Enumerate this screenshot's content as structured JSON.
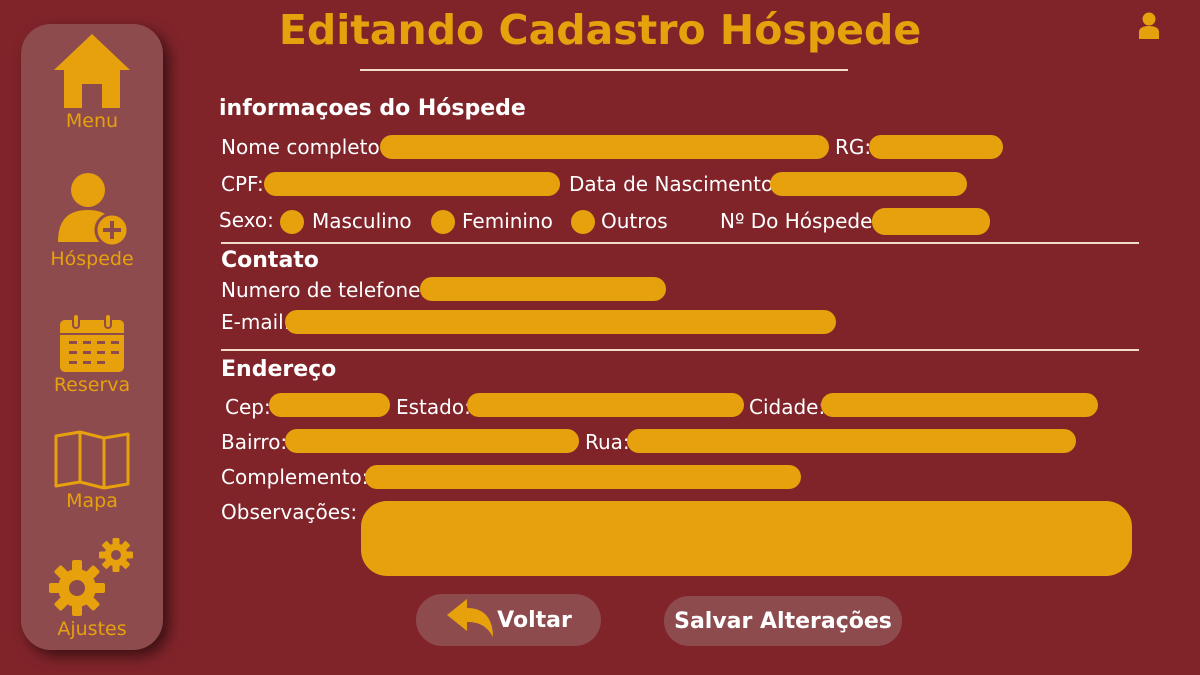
{
  "header": {
    "title": "Editando Cadastro Hóspede"
  },
  "icons": {
    "user": "user-icon",
    "home": "home-icon",
    "add_user": "add-user-icon",
    "calendar": "calendar-icon",
    "map": "map-icon",
    "gears": "gears-icon",
    "back": "back-arrow-icon"
  },
  "colors": {
    "background": "#80242a",
    "sidebar": "#8e4b4e",
    "accent": "#e6a10d",
    "divider": "#f1dcc7"
  },
  "sidebar": {
    "items": [
      {
        "label": "Menu"
      },
      {
        "label": "Hóspede"
      },
      {
        "label": "Reserva"
      },
      {
        "label": "Mapa"
      },
      {
        "label": "Ajustes"
      }
    ]
  },
  "guest_info": {
    "title": "informaçoes do Hóspede",
    "full_name_label": "Nome completo:",
    "rg_label": "RG:",
    "cpf_label": "CPF:",
    "birth_date_label": "Data de Nascimento:",
    "sex_label": "Sexo:",
    "sex_options": [
      "Masculino",
      "Feminino",
      "Outros"
    ],
    "guest_number_label": "Nº Do Hóspede:"
  },
  "contact": {
    "title": "Contato",
    "phone_label": "Numero de telefone:",
    "email_label": "E-mail:"
  },
  "address": {
    "title": "Endereço",
    "cep_label": "Cep:",
    "state_label": "Estado:",
    "city_label": "Cidade:",
    "district_label": "Bairro:",
    "street_label": "Rua:",
    "complement_label": "Complemento:",
    "notes_label": "Observações:"
  },
  "actions": {
    "back_label": "Voltar",
    "save_label": "Salvar Alterações"
  }
}
